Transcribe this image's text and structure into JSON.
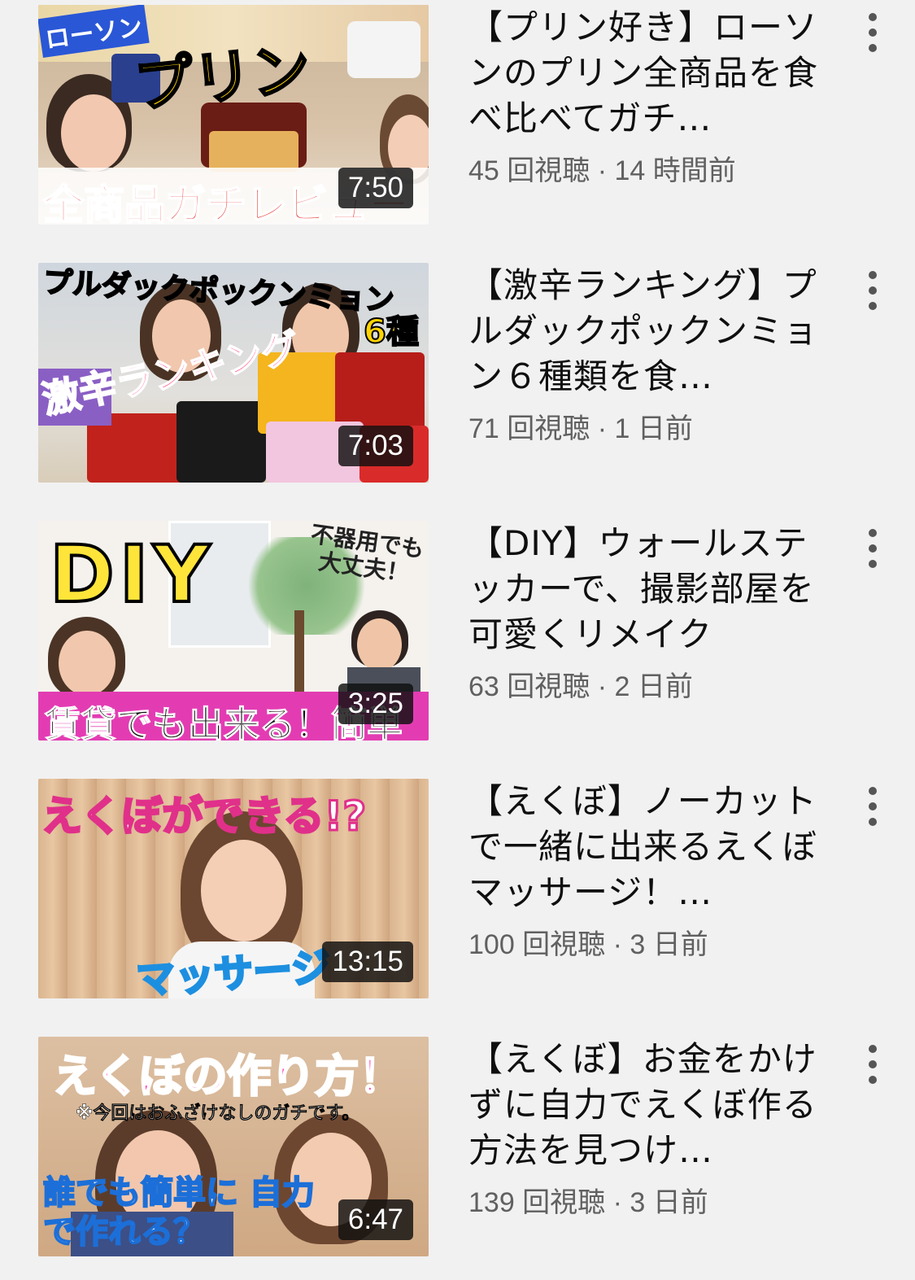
{
  "videos": [
    {
      "thumb_text_top": "ローソン",
      "thumb_text_main": "プリン",
      "thumb_text_bottom": "全商品ガチレビュー",
      "duration": "7:50",
      "title": "【プリン好き】ローソンのプリン全商品を食べ比べてガチ…",
      "meta": "45 回視聴 · 14 時間前"
    },
    {
      "thumb_text_top": "プルダックポックンミョン",
      "thumb_text_main": "激辛ランキング",
      "thumb_text_bottom": "6種",
      "duration": "7:03",
      "title": "【激辛ランキング】プルダックポックンミョン６種類を食…",
      "meta": "71 回視聴 · 1 日前"
    },
    {
      "thumb_text_top": "DIY",
      "thumb_text_main": "不器用でも大丈夫！",
      "thumb_text_bottom": "賃貸でも出来る！簡単",
      "duration": "3:25",
      "title": "【DIY】ウォールステッカーで、撮影部屋を可愛くリメイク",
      "meta": "63 回視聴 · 2 日前"
    },
    {
      "thumb_text_top": "えくぼができる!?",
      "thumb_text_main": "",
      "thumb_text_bottom": "マッサージ",
      "duration": "13:15",
      "title": "【えくぼ】ノーカットで一緒に出来るえくぼマッサージ！…",
      "meta": "100 回視聴 · 3 日前"
    },
    {
      "thumb_text_top": "えくぼの作り方！",
      "thumb_text_main": "※今回はおふざけなしのガチです。",
      "thumb_text_bottom": "誰でも簡単に 自力で作れる？",
      "duration": "6:47",
      "title": "【えくぼ】お金をかけずに自力でえくぼ作る方法を見つけ…",
      "meta": "139 回視聴 · 3 日前"
    }
  ],
  "icons": {
    "menu": "more-vert-icon"
  },
  "colors": {
    "background": "#f1f1f1",
    "title": "#0f0f0f",
    "meta": "#606060"
  }
}
